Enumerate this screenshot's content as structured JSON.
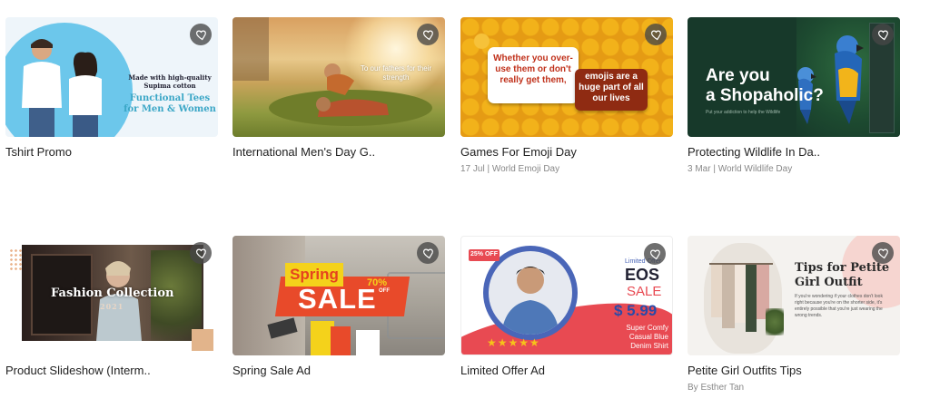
{
  "favorite_icon": "heart-icon",
  "cards": [
    {
      "title": "Tshirt Promo",
      "meta": "",
      "thumb": {
        "text1": "Made with high-quality\nSupima cotton",
        "text2": "Functional Tees\nfor Men & Women"
      }
    },
    {
      "title": "International Men's Day G..",
      "meta": "",
      "thumb": {
        "text1": "To our fathers for their strength"
      }
    },
    {
      "title": "Games For Emoji Day",
      "meta": "17 Jul | World Emoji Day",
      "thumb": {
        "text1": "Whether you over-use them or don't really get them,",
        "text2": "emojis are a huge part of all our lives"
      }
    },
    {
      "title": "Protecting Wildlife In Da..",
      "meta": "3 Mar | World Wildlife Day",
      "thumb": {
        "text1": "Are you\na Shopaholic?",
        "text2": "Put your addiction to help the Wildlife"
      }
    },
    {
      "title": "Product Slideshow (Interm..",
      "meta": "",
      "thumb": {
        "text1": "Fashion Collection",
        "text2": "2021"
      }
    },
    {
      "title": "Spring Sale Ad",
      "meta": "",
      "thumb": {
        "text1": "Spring",
        "text2": "SALE",
        "text3": "70%",
        "text4": "OFF"
      }
    },
    {
      "title": "Limited Offer Ad",
      "meta": "",
      "thumb": {
        "badge": "25% OFF",
        "text1": "Limited Offer",
        "text2": "EOS",
        "text3": "SALE",
        "text4": "$ 5.99",
        "text5": "Super Comfy Casual Blue Denim Shirt",
        "stars": "★★★★★"
      }
    },
    {
      "title": "Petite Girl Outfits Tips",
      "meta": "By Esther Tan",
      "thumb": {
        "text1": "Tips for Petite Girl Outfit",
        "text2": "If you're wondering if your clothes don't look right because you're on the shorter side, it's entirely possible that you're just wearing the wrong trends."
      }
    }
  ]
}
